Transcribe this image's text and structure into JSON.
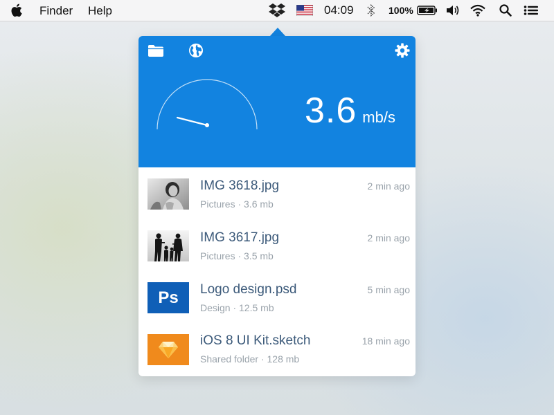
{
  "menubar": {
    "app_menu": "Finder",
    "help_menu": "Help",
    "time": "04:09",
    "battery_percent": "100%",
    "icons": [
      "apple-icon",
      "dropbox-icon",
      "us-flag-icon",
      "bluetooth-icon",
      "battery-icon",
      "volume-icon",
      "wifi-icon",
      "spotlight-search-icon",
      "notification-center-icon"
    ]
  },
  "panel": {
    "header_icons": [
      "folder-icon",
      "globe-icon",
      "gear-icon"
    ],
    "speed_value": "3.6",
    "speed_unit": "mb/s",
    "accent_color": "#1283e0",
    "files": [
      {
        "name": "IMG 3618.jpg",
        "location": "Pictures",
        "size": "3.6 mb",
        "meta": "Pictures · 3.6 mb",
        "time": "2 min ago",
        "thumb": "photo-portrait"
      },
      {
        "name": "IMG 3617.jpg",
        "location": "Pictures",
        "size": "3.5 mb",
        "meta": "Pictures · 3.5 mb",
        "time": "2 min ago",
        "thumb": "photo-family"
      },
      {
        "name": "Logo design.psd",
        "location": "Design",
        "size": "12.5 mb",
        "meta": "Design · 12.5 mb",
        "time": "5 min ago",
        "thumb": "photoshop-icon",
        "thumb_label": "Ps"
      },
      {
        "name": "iOS 8 UI Kit.sketch",
        "location": "Shared folder",
        "size": "128 mb",
        "meta": "Shared folder · 128 mb",
        "time": "18 min ago",
        "thumb": "sketch-icon"
      }
    ]
  }
}
